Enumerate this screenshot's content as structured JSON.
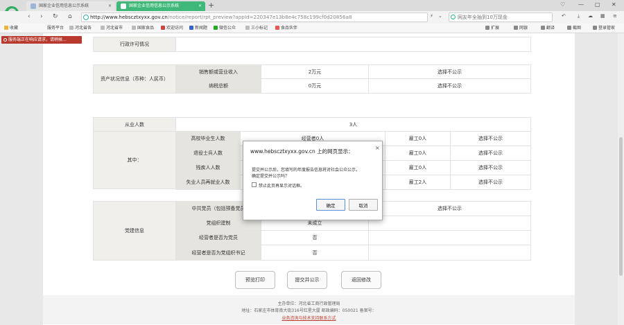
{
  "browser": {
    "tabs": [
      {
        "label": "国家企业信用信息公示系统"
      },
      {
        "label": "国家企业信用信息公示系统"
      }
    ],
    "new_tab": "+",
    "window_controls": [
      "♡",
      "—",
      "▢",
      "✕"
    ],
    "url_domain": "http://www.hebscztxyxx.gov.cn",
    "url_path": "/notice/report/rpt_preview?appId=220347e13b8e4c758c199cf0d20856a8",
    "search_text": "网友年全抽到10万现金",
    "bookmarks": [
      "收藏",
      "服务平台",
      "河北省各",
      "河北省市",
      "国家食品",
      "欢迎访问",
      "新闻题",
      "微信公众",
      "三小标记",
      "食品伙伴"
    ],
    "toolbar_right": [
      "扩展",
      "网银",
      "翻译",
      "截图",
      "登录管家"
    ]
  },
  "notification": "服务端正在响应请求，请稍候...",
  "table": {
    "admin_license": "行政许可情况",
    "asset_section": "资产状况信息（币种：人民币）",
    "asset_rows": [
      {
        "label": "销售额或营业收入",
        "value": "2万元",
        "status": "选择不公示"
      },
      {
        "label": "纳税总额",
        "value": "0万元",
        "status": "选择不公示"
      }
    ],
    "employee_label": "从业人数",
    "employee_value": "3人",
    "among_label": "其中：",
    "among_rows": [
      {
        "label": "高校毕业生人数",
        "owner": "经营者0人",
        "worker": "雇工0人",
        "status": "选择不公示"
      },
      {
        "label": "退役士兵人数",
        "owner": "",
        "worker": "雇工0人",
        "status": "选择不公示"
      },
      {
        "label": "残疾人人数",
        "owner": "",
        "worker": "雇工0人",
        "status": "选择不公示"
      },
      {
        "label": "失业人员再就业人数",
        "owner": "",
        "worker": "雇工2人",
        "status": "选择不公示"
      }
    ],
    "party_section": "党建信息",
    "party_rows": [
      {
        "label": "中共党员（包括预备党员",
        "value": "",
        "status": "选择不公示"
      },
      {
        "label": "党组织建制",
        "value": "未成立",
        "status": ""
      },
      {
        "label": "经营者是否为党员",
        "value": "否",
        "status": ""
      },
      {
        "label": "经营者是否为党组织书记",
        "value": "否",
        "status": ""
      }
    ]
  },
  "buttons": {
    "preview_print": "预览打印",
    "submit_publish": "提交并公示",
    "back_edit": "返回修改"
  },
  "footer": {
    "host": "主办单位：河北省工商行政管理局",
    "address": "地址：石家庄市体育南大街316号红星大厦  邮政编码：050021  备案号：",
    "support": "业务咨询与技术支持联系方式"
  },
  "dialog": {
    "title": "www.hebscztxyxx.gov.cn 上的网页显示：",
    "close": "×",
    "message_line1": "提交并公示后，您填写的年度报告信息将对社会公众公示，",
    "message_line2": "确定提交并公示吗？",
    "checkbox_label": "禁止此页再显示对话框。",
    "ok": "确定",
    "cancel": "取消"
  }
}
